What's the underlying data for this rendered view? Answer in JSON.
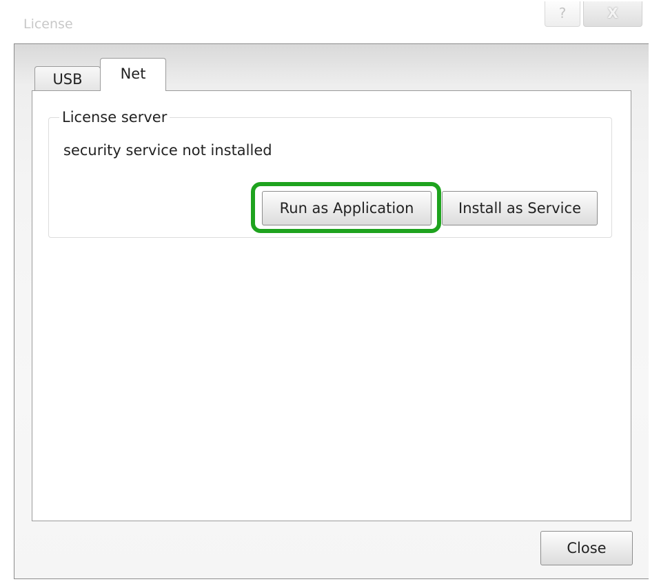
{
  "window": {
    "title": "License",
    "help_button": "?",
    "close_button": "X"
  },
  "tabs": [
    {
      "label": "USB",
      "selected": false
    },
    {
      "label": "Net",
      "selected": true
    }
  ],
  "license_server": {
    "group_title": "License server",
    "status": "security service not installed",
    "run_button": "Run as Application",
    "install_button": "Install as Service"
  },
  "footer": {
    "close_button": "Close"
  },
  "colors": {
    "highlight": "#1ea31e"
  }
}
